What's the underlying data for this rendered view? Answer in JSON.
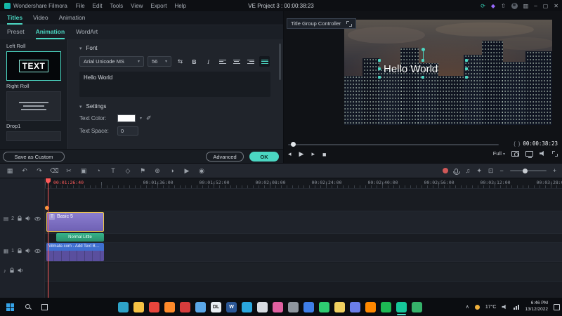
{
  "titlebar": {
    "app_name": "Wondershare Filmora",
    "menus": [
      "File",
      "Edit",
      "Tools",
      "View",
      "Export",
      "Help"
    ],
    "project_title": "VE Project 3 : 00:00:38:23"
  },
  "icons": {
    "caret_down": "▾",
    "collapse": "▾",
    "sync": "⟳",
    "diamond": "◆",
    "export_arrow": "⇧",
    "layout": "▥",
    "minimize": "–",
    "maximize": "▢",
    "close": "✕",
    "brace_open": "{",
    "brace_close": "}",
    "prev_frame": "◂",
    "play": "▶",
    "next_frame": "▸",
    "stop": "■",
    "spacing": "⇆",
    "eyedropper": "✐",
    "track_title": "▤",
    "track_video": "▦",
    "track_audio": "♪",
    "mixer": "♫",
    "plugin": "✦",
    "zoom_fit": "⊡",
    "zoom_out": "−",
    "zoom_in": "+",
    "chevron_up": "∧"
  },
  "panel": {
    "main_tabs": [
      "Titles",
      "Video",
      "Animation"
    ],
    "sub_tabs": [
      "Preset",
      "Animation",
      "WordArt"
    ],
    "presets": {
      "item1_label": "Left Roll",
      "item2_label": "Right Roll",
      "item3_label": "Drop1",
      "preview_text": "TEXT"
    },
    "font": {
      "section_title": "Font",
      "family": "Arial Unicode MS",
      "size": "56",
      "bold": "B",
      "italic": "I",
      "sample_text": "Hello World"
    },
    "settings": {
      "section_title": "Settings",
      "text_color_label": "Text Color:",
      "text_color_value": "#ffffff",
      "text_space_label": "Text Space:",
      "text_space_value": "0"
    },
    "buttons": {
      "save_as_custom": "Save as Custom",
      "advanced": "Advanced",
      "ok": "OK"
    }
  },
  "preview": {
    "controller_label": "Title Group Controller",
    "overlay_text": "Hello World",
    "timecode": "00:00:38:23",
    "quality": "Full"
  },
  "timeline": {
    "playhead_time": "00:01:26:40",
    "ruler_labels": [
      "00:01:36:00",
      "00:01:52:00",
      "00:02:08:00",
      "00:02:24:00",
      "00:02:40:00",
      "00:02:56:00",
      "00:03:12:00",
      "00:03:28:00"
    ],
    "toolbar_icons": [
      {
        "name": "media-icon",
        "glyph": "▦"
      },
      {
        "name": "undo-icon",
        "glyph": "↶"
      },
      {
        "name": "redo-icon",
        "glyph": "↷"
      },
      {
        "name": "delete-icon",
        "glyph": "⌫"
      },
      {
        "name": "split-icon",
        "glyph": "✂"
      },
      {
        "name": "crop-icon",
        "glyph": "▣"
      },
      {
        "name": "speed-icon",
        "glyph": "◔"
      },
      {
        "name": "text-tool-icon",
        "glyph": "T"
      },
      {
        "name": "keyframe-icon",
        "glyph": "◇"
      },
      {
        "name": "marker-icon",
        "glyph": "⚑"
      },
      {
        "name": "motion-track-icon",
        "glyph": "⊕"
      },
      {
        "name": "color-icon",
        "glyph": "◑"
      },
      {
        "name": "render-icon",
        "glyph": "▶"
      },
      {
        "name": "snapshot-icon",
        "glyph": "◉"
      }
    ],
    "tracks": {
      "title_track_num": "2",
      "video_track_num": "1"
    },
    "clips": {
      "title_icon": "T",
      "title_clip": "Basic 5",
      "subtitle_clip": "Normal Little",
      "video_clip": "Vilmate.com - Add Text Beh..."
    }
  },
  "taskbar": {
    "icons": [
      {
        "name": "edge-icon",
        "color": "#2ea3c8"
      },
      {
        "name": "folder-icon",
        "color": "#f6c244"
      },
      {
        "name": "chrome-icon",
        "color": "#e8453c"
      },
      {
        "name": "firefox-icon",
        "color": "#ff8a2a"
      },
      {
        "name": "opera-icon",
        "color": "#d63c3c"
      },
      {
        "name": "notepad-icon",
        "color": "#5aa7e8"
      },
      {
        "name": "docs-icon",
        "color": "#e9edf2",
        "label": "DL",
        "lc": "#222222"
      },
      {
        "name": "word-icon",
        "color": "#2b5797",
        "label": "W",
        "lc": "#ffffff"
      },
      {
        "name": "telegram-icon",
        "color": "#2aa7de"
      },
      {
        "name": "camera-icon",
        "color": "#d8dce2"
      },
      {
        "name": "paint-icon",
        "color": "#e060a0"
      },
      {
        "name": "settings-icon",
        "color": "#8f969e"
      },
      {
        "name": "store-icon",
        "color": "#3f7ee8"
      },
      {
        "name": "whatsapp-icon",
        "color": "#2ecc71"
      },
      {
        "name": "crown-icon",
        "color": "#f0d060"
      },
      {
        "name": "discord-icon",
        "color": "#6a7de8"
      },
      {
        "name": "vlc-icon",
        "color": "#ff8800"
      },
      {
        "name": "spotify-icon",
        "color": "#1db954"
      },
      {
        "name": "filmora-icon",
        "color": "#16c79a",
        "cls": "active"
      },
      {
        "name": "recorder-icon",
        "color": "#35b26a"
      }
    ],
    "weather_temp": "17°C",
    "clock_time": "6:46 PM",
    "clock_date": "13/12/2022"
  }
}
